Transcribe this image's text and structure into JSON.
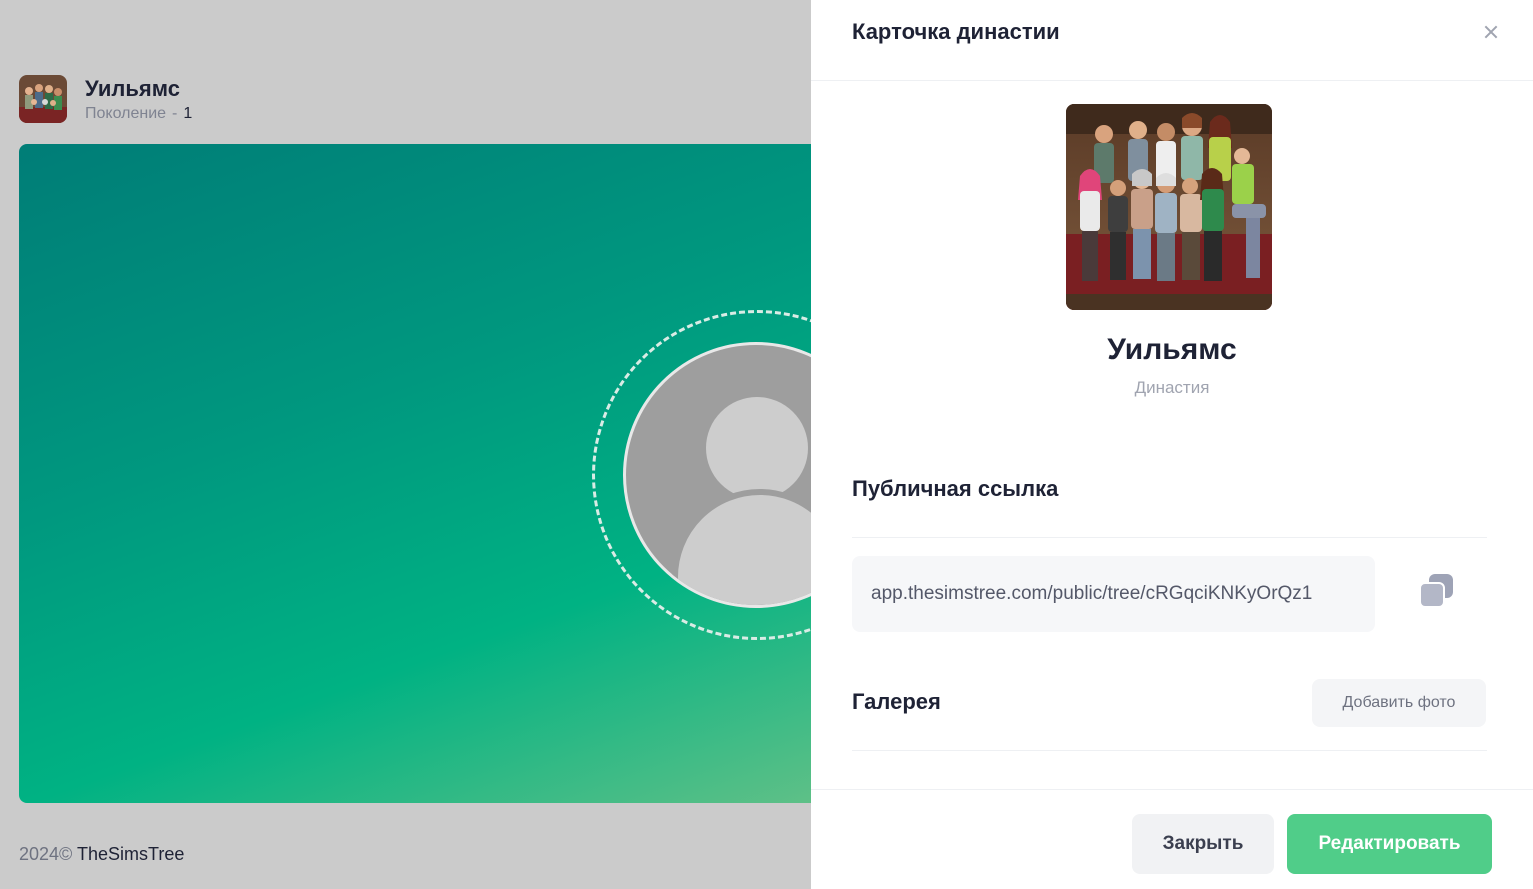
{
  "background": {
    "tree_name": "Уильямс",
    "generation_label": "Поколение",
    "generation_separator": "-",
    "generation_value": "1",
    "footer_year": "2024©",
    "footer_brand": "TheSimsTree",
    "canvas_colors": [
      "#007d77",
      "#00b283",
      "#5ec087"
    ]
  },
  "drawer": {
    "title": "Карточка династии",
    "close_icon": "close-icon",
    "dynasty_name": "Уильямс",
    "dynasty_kind": "Династия",
    "public_link": {
      "title": "Публичная ссылка",
      "url": "app.thesimstree.com/public/tree/cRGqciKNKyOrQz1",
      "copy_icon": "copy-icon"
    },
    "gallery": {
      "title": "Галерея",
      "add_photo_label": "Добавить фото"
    },
    "footer": {
      "close_label": "Закрыть",
      "edit_label": "Редактировать"
    }
  },
  "colors": {
    "accent": "#50cd89",
    "text_primary": "#1e2235",
    "text_muted": "#a0a4b0"
  }
}
